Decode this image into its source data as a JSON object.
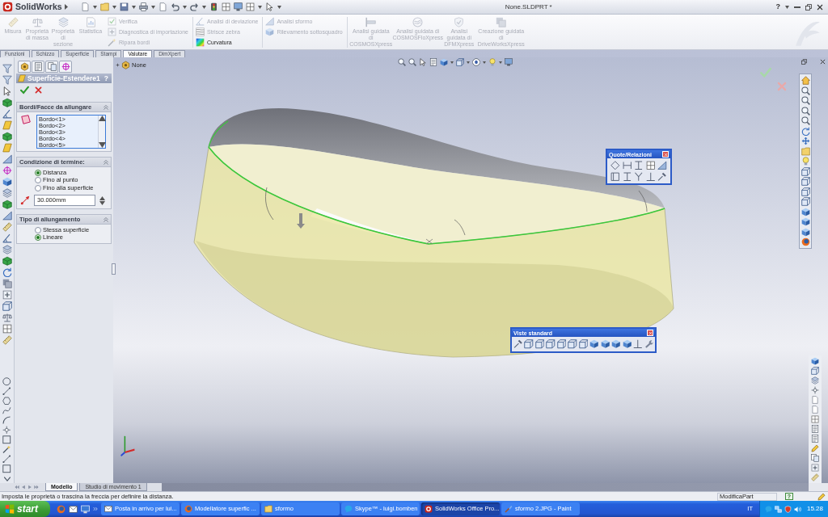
{
  "title_bar": {
    "app_name": "SolidWorks",
    "document_title": "None.SLDPRT *",
    "help_label": "?"
  },
  "ribbon": {
    "groups": [
      {
        "kind": "large",
        "items": [
          {
            "label": "Misura",
            "disabled": true
          },
          {
            "label": "Proprietà di massa",
            "disabled": true
          },
          {
            "label": "Proprietà di sezione",
            "disabled": true
          },
          {
            "label": "Statistica",
            "disabled": true
          }
        ]
      },
      {
        "kind": "small",
        "items": [
          {
            "label": "Verifica",
            "disabled": true
          },
          {
            "label": "Diagnostica di importazione",
            "disabled": true
          },
          {
            "label": "Ripara bordi",
            "disabled": true
          }
        ]
      },
      {
        "kind": "small",
        "items": [
          {
            "label": "Analisi di deviazione",
            "disabled": true
          },
          {
            "label": "Strisce zebra",
            "disabled": true
          },
          {
            "label": "Curvatura",
            "disabled": false
          }
        ]
      },
      {
        "kind": "small",
        "items": [
          {
            "label": "Analisi sformo",
            "disabled": true
          },
          {
            "label": "Rilevamento sottosquadro",
            "disabled": true
          }
        ]
      },
      {
        "kind": "large",
        "items": [
          {
            "label": "Analisi guidata di COSMOSXpress",
            "disabled": true
          },
          {
            "label": "Analisi guidata di COSMOSFloXpress",
            "disabled": true
          },
          {
            "label": "Analisi guidata di DFMXpress",
            "disabled": true
          },
          {
            "label": "Creazione guidata di DriveWorksXpress",
            "disabled": true
          }
        ]
      }
    ]
  },
  "command_tabs": [
    {
      "label": "Funzioni",
      "selected": false
    },
    {
      "label": "Schizzo",
      "selected": false
    },
    {
      "label": "Superficie",
      "selected": false
    },
    {
      "label": "Stampi",
      "selected": false
    },
    {
      "label": "Valutare",
      "selected": true
    },
    {
      "label": "DimXpert",
      "selected": false
    }
  ],
  "property_manager": {
    "title": "Superficie-Estendere1",
    "help_label": "?",
    "sections": [
      {
        "kind": "selection_list",
        "title": "Bordi/Facce da allungare",
        "items": [
          "Bordo<1>",
          "Bordo<2>",
          "Bordo<3>",
          "Bordo<4>",
          "Bordo<5>"
        ]
      },
      {
        "kind": "options",
        "title": "Condizione di termine:",
        "options": [
          {
            "label": "Distanza",
            "selected": true
          },
          {
            "label": "Fino al punto",
            "selected": false
          },
          {
            "label": "Fino alla superficie",
            "selected": false
          }
        ],
        "distance": "30.000mm"
      },
      {
        "kind": "options",
        "title": "Tipo di allungamento",
        "options": [
          {
            "label": "Stessa superficie",
            "selected": false
          },
          {
            "label": "Lineare",
            "selected": true
          }
        ]
      }
    ]
  },
  "viewport": {
    "feature_tree": {
      "label": "None"
    },
    "floating_toolbars": [
      {
        "kind": "dimensions",
        "title": "Quote/Relazioni"
      },
      {
        "kind": "views",
        "title": "Viste standard"
      }
    ]
  },
  "bottom_tabs": [
    {
      "label": "Modello",
      "selected": true
    },
    {
      "label": "Studio di movimento 1",
      "selected": false
    }
  ],
  "status_bar": {
    "message": "Imposta le proprietà o trascina la freccia per definire la distanza.",
    "mode": "ModificaPart",
    "help_label": "?"
  },
  "taskbar": {
    "start_label": "start",
    "tasks": [
      {
        "label": "Posta in arrivo per lui...",
        "selected": false
      },
      {
        "label": "Modellatore superfic ...",
        "selected": false
      },
      {
        "label": "sformo",
        "selected": false
      },
      {
        "label": "Skype™ - luigi.bomben",
        "selected": false
      },
      {
        "label": "SolidWorks Office Pro...",
        "selected": true
      },
      {
        "label": "sformo 2.JPG - Paint",
        "selected": false
      }
    ],
    "language": "IT",
    "clock": "15.28"
  }
}
